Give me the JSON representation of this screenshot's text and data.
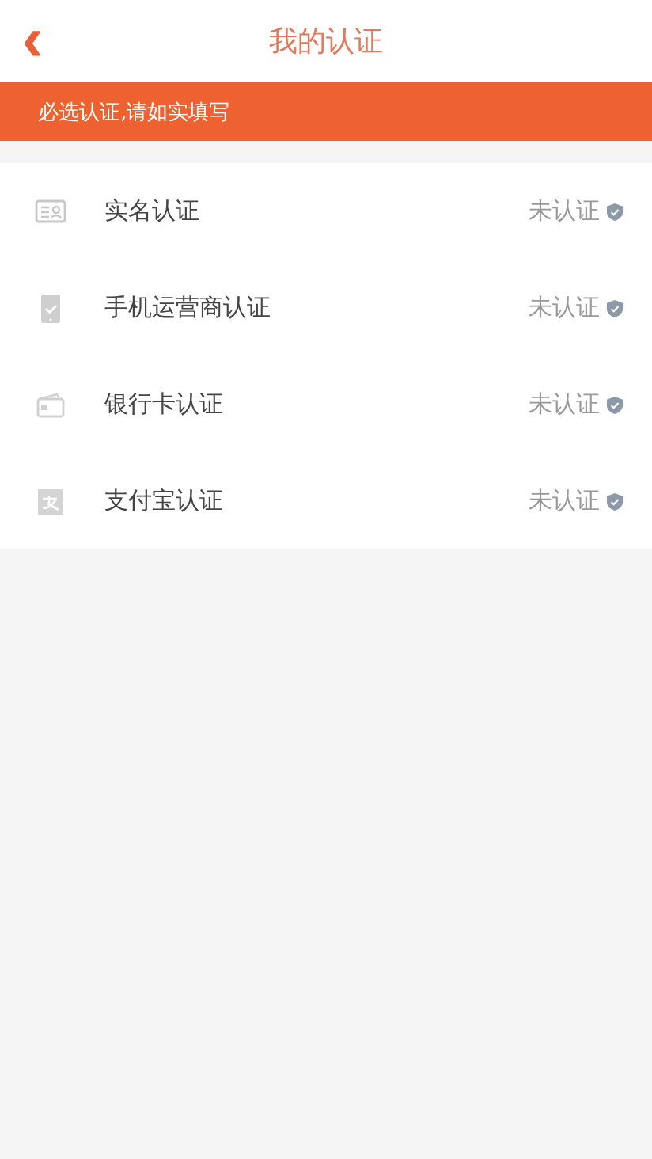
{
  "header": {
    "back": "‹",
    "title": "我的认证"
  },
  "notice": "必选认证,请如实填写",
  "items": [
    {
      "kind": "id-card",
      "label": "实名认证",
      "status": "未认证"
    },
    {
      "kind": "phone",
      "label": "手机运营商认证",
      "status": "未认证"
    },
    {
      "kind": "bank-card",
      "label": "银行卡认证",
      "status": "未认证"
    },
    {
      "kind": "alipay",
      "label": "支付宝认证",
      "status": "未认证"
    }
  ]
}
